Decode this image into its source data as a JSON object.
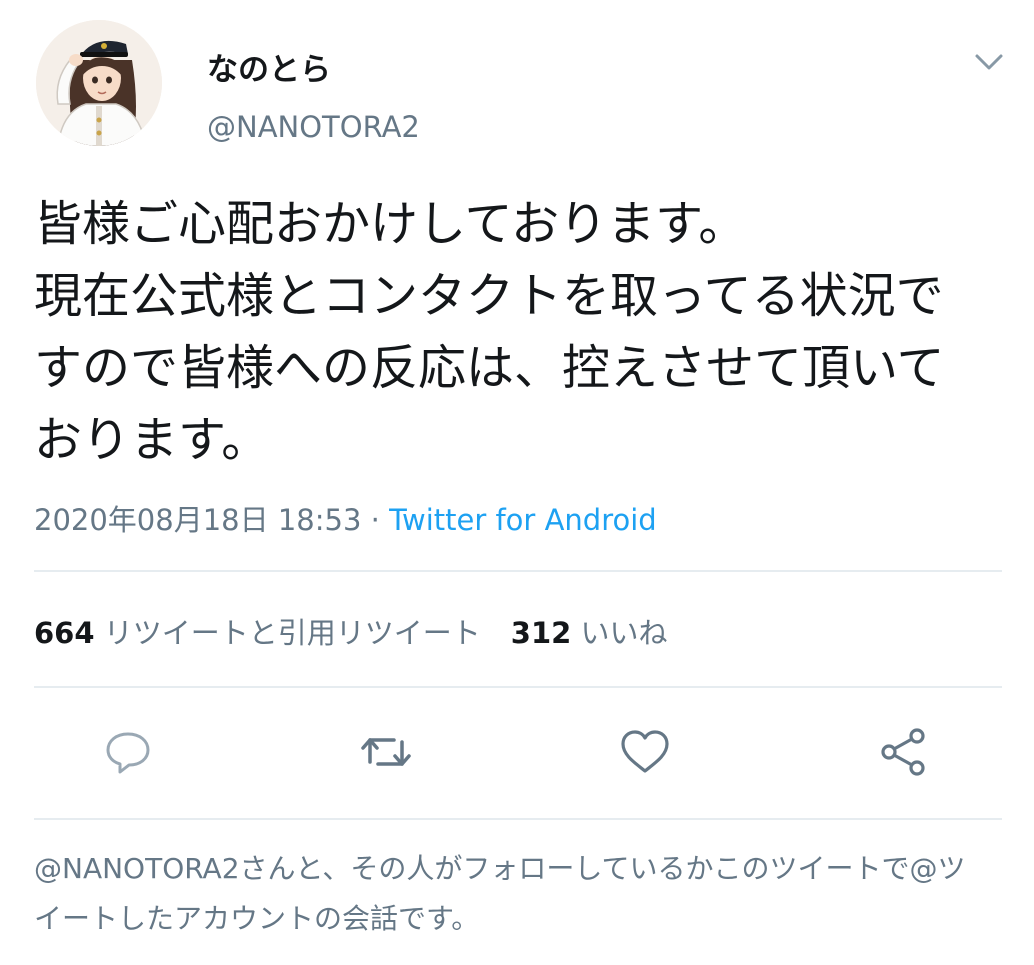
{
  "tweet": {
    "author": {
      "display_name": "なのとら",
      "handle": "@NANOTORA2"
    },
    "text_lines": [
      "皆様ご心配おかけしております。",
      "現在公式様とコンタクトを取ってる状況で",
      "すので皆様への反応は、控えさせて頂いて",
      "おります。"
    ],
    "timestamp": "2020年08月18日 18:53",
    "separator": "·",
    "source": "Twitter for Android",
    "stats": {
      "retweets_count": "664",
      "retweets_label": "リツイートと引用リツイート",
      "likes_count": "312",
      "likes_label": "いいね"
    }
  },
  "actions": {
    "icons": [
      "reply-icon",
      "retweet-icon",
      "like-icon",
      "share-icon"
    ],
    "icon_color": "#657786"
  },
  "footer": {
    "lines": [
      "@NANOTORA2さんと、その人がフォローしているかこのツイートで@ツ",
      "イートしたアカウントの会話です。"
    ]
  },
  "colors": {
    "text": "#14171a",
    "secondary": "#657786",
    "link": "#1da1f2",
    "divider": "#e6ecf0"
  }
}
